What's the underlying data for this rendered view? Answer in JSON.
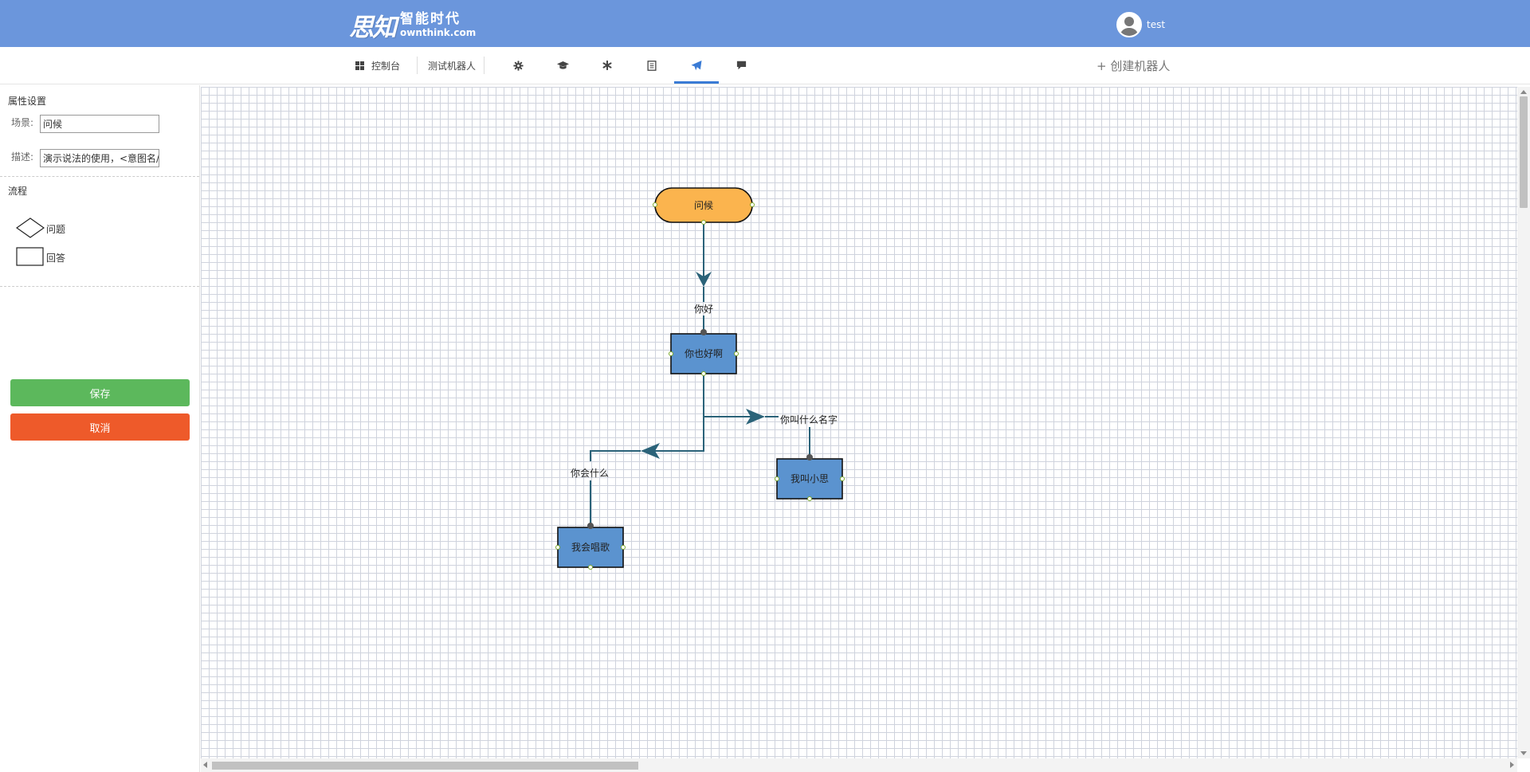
{
  "header": {
    "logo_mark": "思知",
    "logo_cn": "智能时代",
    "logo_en": "ownthink.com",
    "username": "test"
  },
  "nav": {
    "dashboard": "控制台",
    "robot_name": "测试机器人",
    "icons": [
      "gear-icon",
      "graduation-cap-icon",
      "asterisk-icon",
      "book-icon",
      "paper-plane-icon",
      "comment-icon"
    ],
    "active": "paper-plane-icon",
    "create_robot": "+ 创建机器人"
  },
  "sidebar": {
    "props_title": "属性设置",
    "scene_label": "场景:",
    "scene_value": "问候",
    "desc_label": "描述:",
    "desc_value": "演示说法的使用，<意图名/",
    "flow_title": "流程",
    "shape_question": "问题",
    "shape_answer": "回答",
    "save": "保存",
    "cancel": "取消"
  },
  "flow": {
    "start": "问候",
    "nodes": {
      "a1": "你也好啊",
      "a2": "我叫小思",
      "a3": "我会唱歌"
    },
    "edges": {
      "e1": "你好",
      "e2": "你叫什么名字",
      "e3": "你会什么"
    }
  },
  "colors": {
    "header_bg": "#6b96dc",
    "start_fill": "#fbb44e",
    "node_fill": "#5b93cf",
    "edge": "#2b6379",
    "save": "#5cb85c",
    "cancel": "#ee5a2a"
  }
}
